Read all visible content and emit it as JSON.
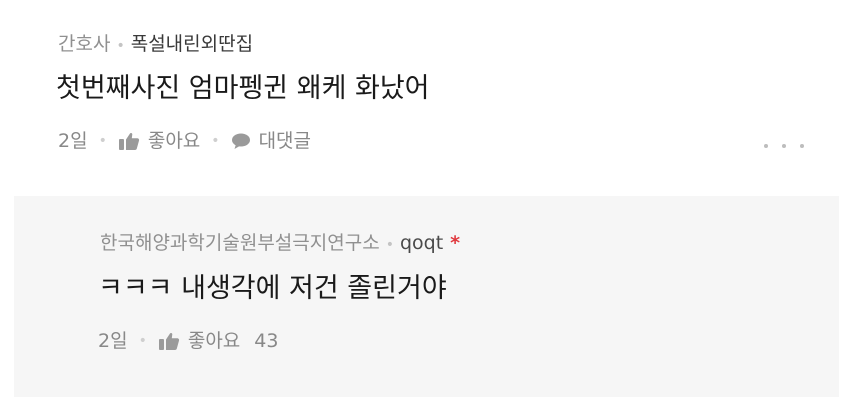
{
  "comment": {
    "author": "간호사",
    "company": "폭설내린외딴집",
    "text": "첫번째사진 엄마펭귄 왜케 화났어",
    "time": "2일",
    "like_label": "좋아요",
    "reply_label": "대댓글",
    "icons": {
      "like": "thumbs-up-icon",
      "reply": "speech-bubble-icon",
      "more": "more-dots-icon"
    }
  },
  "reply": {
    "author": "한국해양과학기술원부설극지연구소",
    "company": "qoqt",
    "star": "*",
    "text": "ㅋㅋㅋ 내생각에 저건 졸린거야",
    "time": "2일",
    "like_label": "좋아요",
    "like_count": "43",
    "icons": {
      "like": "thumbs-up-icon"
    }
  },
  "colors": {
    "star": "#e0383e",
    "reply_background": "#f6f6f6",
    "muted_text": "#888888"
  }
}
